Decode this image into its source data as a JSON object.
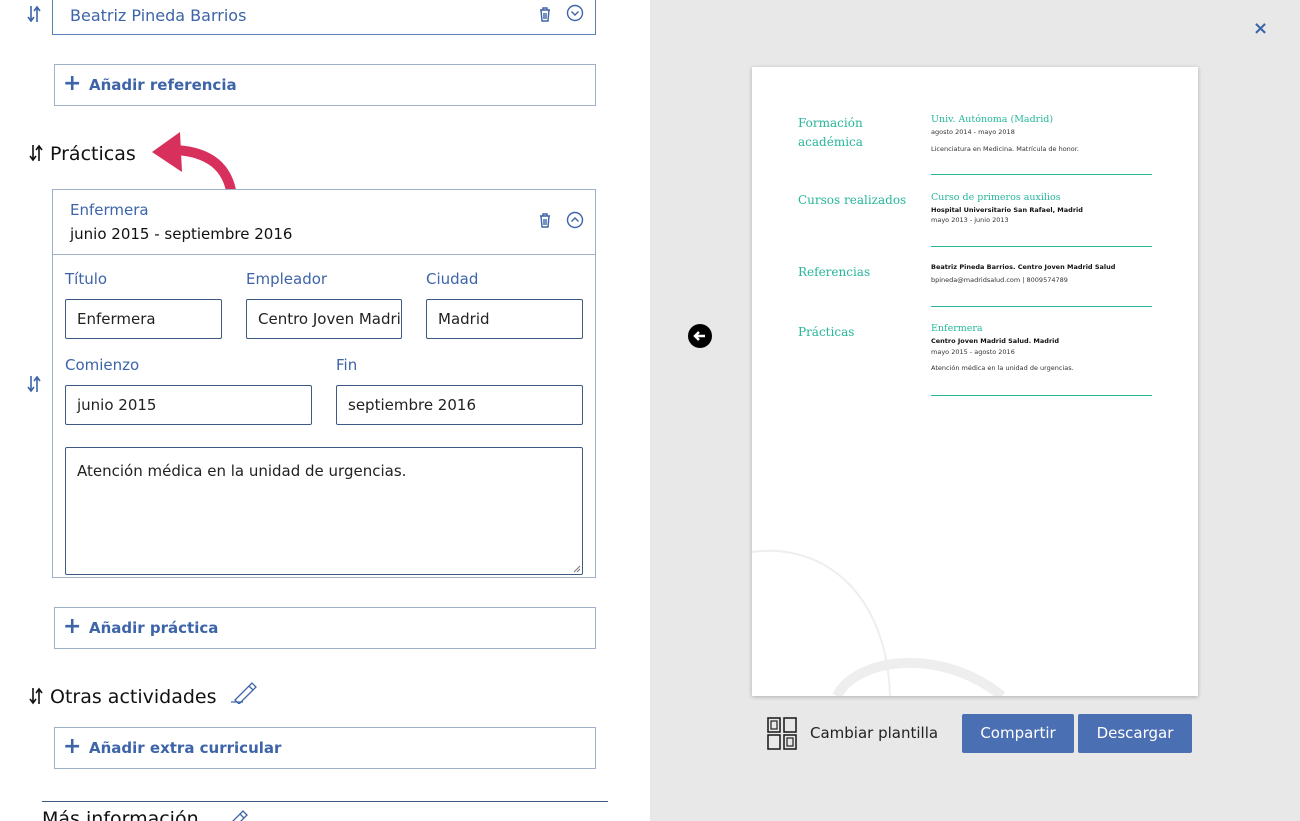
{
  "editor": {
    "reference_item": {
      "name": "Beatriz Pineda Barrios"
    },
    "add_reference_label": "Añadir referencia",
    "practices": {
      "title": "Prácticas",
      "item": {
        "title": "Enfermera",
        "dates": "junio 2015 - septiembre 2016",
        "fields": {
          "title_label": "Título",
          "title_value": "Enfermera",
          "employer_label": "Empleador",
          "employer_value": "Centro Joven Madrid Salud",
          "city_label": "Ciudad",
          "city_value": "Madrid",
          "start_label": "Comienzo",
          "start_value": "junio 2015",
          "end_label": "Fin",
          "end_value": "septiembre 2016",
          "description": "Atención médica en la unidad de urgencias."
        }
      },
      "add_label": "Añadir práctica"
    },
    "other_activities": {
      "title": "Otras actividades",
      "add_label": "Añadir extra curricular"
    },
    "more_info_title": "Más información"
  },
  "preview": {
    "close_label": "×",
    "sections": [
      {
        "heading": "Formación académica",
        "title": "Univ. Autónoma (Madrid)",
        "dates": "agosto 2014 - mayo 2018",
        "description": "Licenciatura en Medicina. Matrícula de honor."
      },
      {
        "heading": "Cursos realizados",
        "title": "Curso de primeros auxilios",
        "org": "Hospital Universitario San Rafael, Madrid",
        "dates": "mayo 2013 - junio 2013"
      },
      {
        "heading": "Referencias",
        "org": "Beatriz Pineda Barrios. Centro Joven Madrid Salud",
        "contact": "bpineda@madridsalud.com | 8009574789"
      },
      {
        "heading": "Prácticas",
        "title": "Enfermera",
        "org": "Centro Joven Madrid Salud. Madrid",
        "dates": "mayo 2015 - agosto 2016",
        "description": "Atención médica en la unidad de urgencias."
      }
    ],
    "change_template_label": "Cambiar plantilla",
    "share_label": "Compartir",
    "download_label": "Descargar"
  },
  "colors": {
    "accent_blue": "#3d64a8",
    "button_blue": "#4a6fb3",
    "cv_green": "#26b69b",
    "arrow_pink": "#d8305c"
  }
}
